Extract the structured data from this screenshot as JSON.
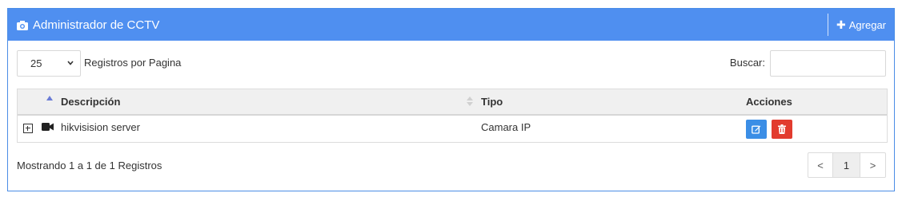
{
  "header": {
    "title": "Administrador de CCTV",
    "add_label": "Agregar",
    "bg_color": "#4f8ff0"
  },
  "toolbar": {
    "page_size": "25",
    "page_size_label": "Registros por Pagina",
    "search_label": "Buscar:",
    "search_value": ""
  },
  "table": {
    "columns": [
      "Descripción",
      "Tipo",
      "Acciones"
    ],
    "rows": [
      {
        "description": "hikvisision server",
        "type": "Camara IP"
      }
    ]
  },
  "footer": {
    "info": "Mostrando 1 a 1 de 1 Registros",
    "prev": "<",
    "page": "1",
    "next": ">"
  },
  "colors": {
    "edit": "#3b8ee6",
    "delete": "#e23b2e"
  }
}
